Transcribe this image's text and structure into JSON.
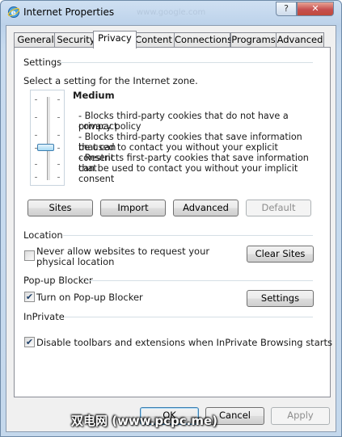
{
  "window": {
    "title": "Internet Properties",
    "ghost_url": "www.google.com",
    "help_label": "?",
    "close_label": "✕"
  },
  "tabs": [
    {
      "label": "General"
    },
    {
      "label": "Security"
    },
    {
      "label": "Privacy"
    },
    {
      "label": "Content"
    },
    {
      "label": "Connections"
    },
    {
      "label": "Programs"
    },
    {
      "label": "Advanced"
    }
  ],
  "active_tab": "Privacy",
  "settings": {
    "heading": "Settings",
    "instruction": "Select a setting for the Internet zone.",
    "level": "Medium",
    "slider_position": "Medium",
    "description": [
      "- Blocks third-party cookies that do not have a compact",
      "privacy policy",
      "- Blocks third-party cookies that save information that can",
      "be used to contact you without your explicit consent",
      "- Restricts first-party cookies that save information that",
      "can be used to contact you without your implicit consent"
    ],
    "buttons": {
      "sites": "Sites",
      "import": "Import",
      "advanced": "Advanced",
      "default": "Default"
    }
  },
  "location": {
    "heading": "Location",
    "checkbox_line1": "Never allow websites to request your",
    "checkbox_line2": "physical location",
    "checked": false,
    "clear_sites": "Clear Sites"
  },
  "popup": {
    "heading": "Pop-up Blocker",
    "checkbox_label": "Turn on Pop-up Blocker",
    "checked": true,
    "settings": "Settings"
  },
  "inprivate": {
    "heading": "InPrivate",
    "checkbox_label": "Disable toolbars and extensions when InPrivate Browsing starts",
    "checked": true
  },
  "footer": {
    "ok": "OK",
    "cancel": "Cancel",
    "apply": "Apply"
  },
  "watermark": "双电网 (www.pcpc.me)",
  "colors": {
    "frame": "#c4d8ec",
    "close": "#c75050",
    "focus": "#3c7fb1"
  }
}
